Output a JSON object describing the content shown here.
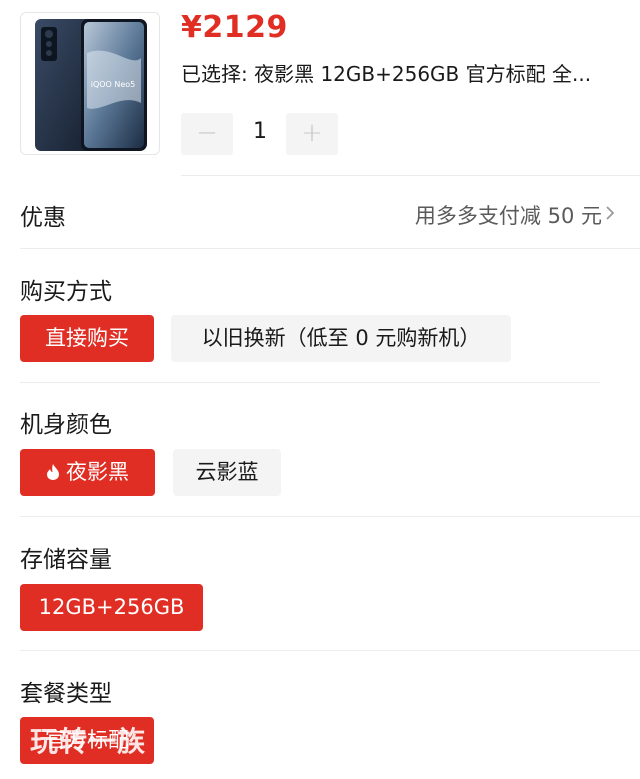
{
  "product": {
    "price": "¥2129",
    "selected_text": "已选择: 夜影黑 12GB+256GB 官方标配 全...",
    "image_brand_text": "iQOO Neo5",
    "quantity": "1",
    "minus_symbol": "−",
    "plus_symbol": "+"
  },
  "promo": {
    "label": "优惠",
    "value": "用多多支付减 50 元"
  },
  "sections": {
    "purchase_method": {
      "title": "购买方式",
      "options": [
        "直接购买",
        "以旧换新（低至 0 元购新机）"
      ],
      "selected_index": 0
    },
    "color": {
      "title": "机身颜色",
      "options": [
        "夜影黑",
        "云影蓝"
      ],
      "selected_index": 0
    },
    "storage": {
      "title": "存储容量",
      "options": [
        "12GB+256GB"
      ],
      "selected_index": 0
    },
    "package": {
      "title": "套餐类型",
      "options": [
        "官方标配"
      ],
      "selected_index": 0
    }
  },
  "watermark": "玩转一族",
  "colors": {
    "accent": "#e02e24",
    "option_bg": "#f4f4f4",
    "divider": "#ececec"
  },
  "icons": {
    "chevron": "chevron-right-icon",
    "flame": "flame-icon"
  }
}
